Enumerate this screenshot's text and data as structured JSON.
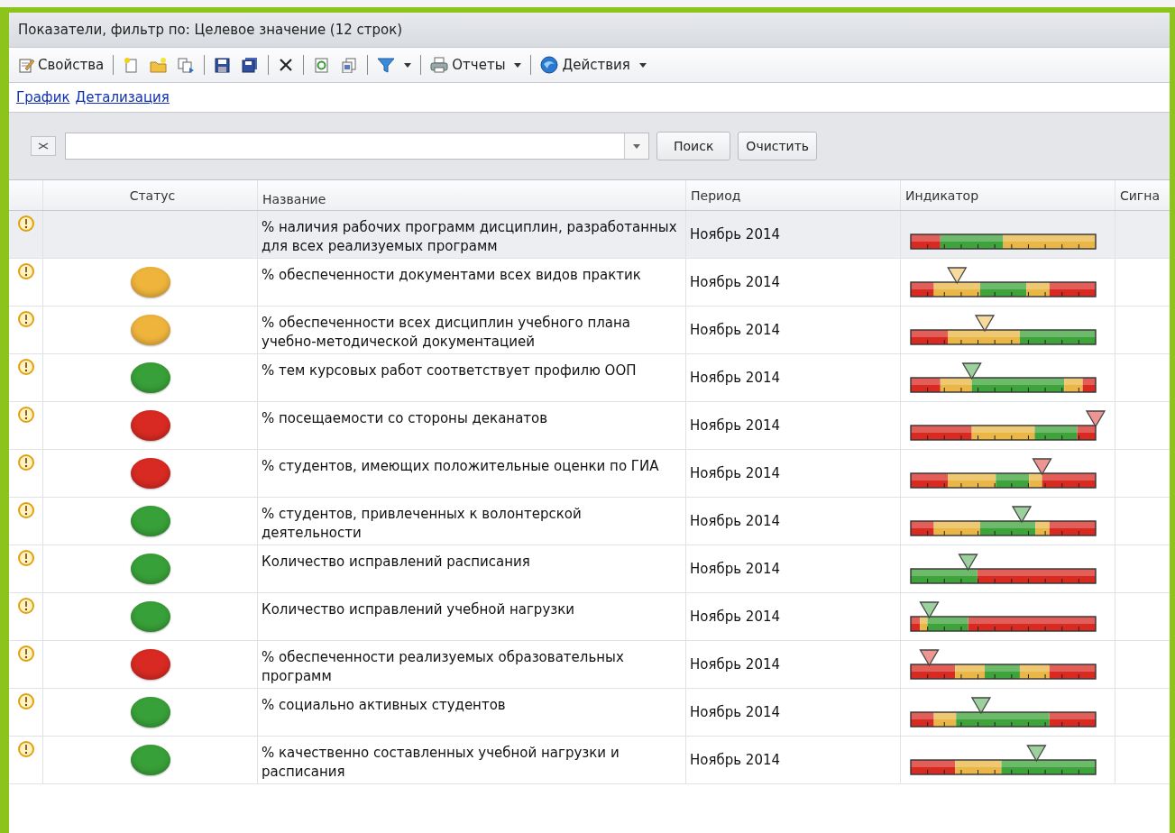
{
  "window": {
    "title": "Показатели,  фильтр по: Целевое значение (12 строк)"
  },
  "toolbar": [
    {
      "label": "Свойства",
      "dropdown": false
    },
    {
      "label": "Отчеты",
      "dropdown": true
    },
    {
      "label": "Действия",
      "dropdown": true
    }
  ],
  "links": [
    "График",
    "Детализация"
  ],
  "search": {
    "search_button": "Поиск",
    "clear_button": "Очистить"
  },
  "table": {
    "columns": [
      "Статус",
      "Название",
      "Период",
      "Индикатор",
      "Сигна"
    ],
    "rows": [
      {
        "selected": true,
        "name": "% наличия рабочих программ дисциплин, разработанных для всех реализуемых программ",
        "period": "Ноябрь 2014",
        "indicator": {
          "segments": [
            {
              "color": "#d92a22"
            },
            {
              "color": "#3ea33a"
            },
            {
              "color": "#eab646"
            }
          ]
        }
      },
      {
        "selected": false,
        "status": {
          "color": "#efb43c"
        },
        "name": "% обеспеченности документами всех видов практик",
        "period": "Ноябрь 2014",
        "indicator": {
          "segments": [
            {
              "color": "#d92a22"
            },
            {
              "color": "#eab646"
            },
            {
              "color": "#3ea33a"
            },
            {
              "color": "#eab646"
            },
            {
              "color": "#d92a22"
            }
          ]
        }
      },
      {
        "selected": false,
        "status": {
          "color": "#efb43c"
        },
        "name": "% обеспеченности всех дисциплин учебного плана учебно-методической документацией",
        "period": "Ноябрь 2014",
        "indicator": {
          "segments": [
            {
              "color": "#d92a22"
            },
            {
              "color": "#eab646"
            },
            {
              "color": "#3ea33a"
            }
          ]
        }
      },
      {
        "selected": false,
        "status": {
          "color": "#38a038"
        },
        "name": "% тем курсовых работ соответствует профилю ООП",
        "period": "Ноябрь 2014",
        "indicator": {
          "segments": [
            {
              "color": "#d92a22"
            },
            {
              "color": "#eab646"
            },
            {
              "color": "#3ea33a"
            },
            {
              "color": "#eab646"
            },
            {
              "color": "#d92a22"
            }
          ]
        }
      },
      {
        "selected": false,
        "status": {
          "color": "#d82a22"
        },
        "name": "% посещаемости со стороны деканатов",
        "period": "Ноябрь 2014",
        "indicator": {
          "segments": [
            {
              "color": "#d92a22"
            },
            {
              "color": "#eab646"
            },
            {
              "color": "#3ea33a"
            },
            {
              "color": "#d92a22"
            }
          ]
        }
      },
      {
        "selected": false,
        "status": {
          "color": "#d82a22"
        },
        "name": "% студентов, имеющих положительные оценки по ГИА",
        "period": "Ноябрь 2014",
        "indicator": {
          "segments": [
            {
              "color": "#d92a22"
            },
            {
              "color": "#eab646"
            },
            {
              "color": "#3ea33a"
            },
            {
              "color": "#eab646"
            },
            {
              "color": "#d92a22"
            }
          ]
        }
      },
      {
        "selected": false,
        "status": {
          "color": "#38a038"
        },
        "name": "% студентов, привлеченных к волонтерской деятельности",
        "period": "Ноябрь 2014",
        "indicator": {
          "segments": [
            {
              "color": "#d92a22"
            },
            {
              "color": "#eab646"
            },
            {
              "color": "#3ea33a"
            },
            {
              "color": "#eab646"
            },
            {
              "color": "#d92a22"
            }
          ]
        }
      },
      {
        "selected": false,
        "status": {
          "color": "#38a038"
        },
        "name": "Количество исправлений расписания",
        "period": "Ноябрь 2014",
        "indicator": {
          "segments": [
            {
              "color": "#3ea33a"
            },
            {
              "color": "#d92a22"
            }
          ]
        }
      },
      {
        "selected": false,
        "status": {
          "color": "#38a038"
        },
        "name": "Количество исправлений учебной нагрузки",
        "period": "Ноябрь 2014",
        "indicator": {
          "segments": [
            {
              "color": "#d92a22"
            },
            {
              "color": "#eab646"
            },
            {
              "color": "#3ea33a"
            },
            {
              "color": "#d92a22"
            }
          ]
        }
      },
      {
        "selected": false,
        "status": {
          "color": "#d82a22"
        },
        "name": "% обеспеченности реализуемых образовательных программ",
        "period": "Ноябрь 2014",
        "indicator": {
          "segments": [
            {
              "color": "#d92a22"
            },
            {
              "color": "#eab646"
            },
            {
              "color": "#3ea33a"
            },
            {
              "color": "#eab646"
            },
            {
              "color": "#d92a22"
            }
          ]
        }
      },
      {
        "selected": false,
        "status": {
          "color": "#38a038"
        },
        "name": "% социально активных студентов",
        "period": "Ноябрь 2014",
        "indicator": {
          "segments": [
            {
              "color": "#d92a22"
            },
            {
              "color": "#eab646"
            },
            {
              "color": "#3ea33a"
            },
            {
              "color": "#d92a22"
            }
          ]
        }
      },
      {
        "selected": false,
        "status": {
          "color": "#38a038"
        },
        "name": "% качественно составленных учебной нагрузки и расписания",
        "period": "Ноябрь 2014",
        "indicator": {
          "segments": [
            {
              "color": "#d92a22"
            },
            {
              "color": "#eab646"
            },
            {
              "color": "#3ea33a"
            }
          ]
        }
      }
    ]
  }
}
